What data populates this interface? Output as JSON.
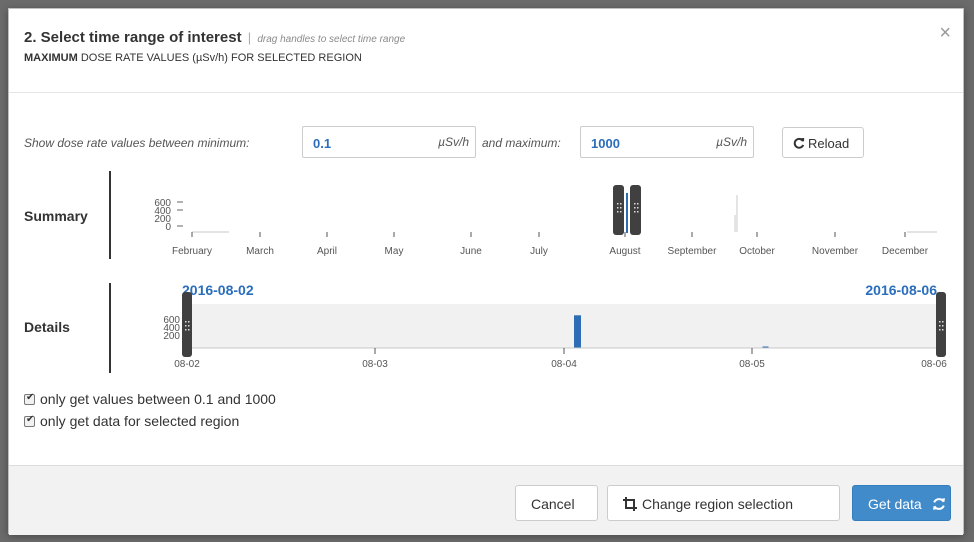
{
  "header": {
    "title": "2. Select time range of interest",
    "separator": "|",
    "hint": "drag handles to select time range",
    "subtitle_bold": "MAXIMUM",
    "subtitle_rest": " DOSE RATE VALUES (µSv/h) FOR SELECTED REGION",
    "close_symbol": "×"
  },
  "range": {
    "min_label": "Show dose rate values between minimum:",
    "min_value": "0.1",
    "min_unit": "µSv/h",
    "max_label": "and maximum:",
    "max_value": "1000",
    "max_unit": "µSv/h",
    "reload_label": "Reload"
  },
  "summary": {
    "label": "Summary",
    "y_ticks": [
      "600",
      "400",
      "200",
      "0"
    ],
    "months": [
      "February",
      "March",
      "April",
      "May",
      "June",
      "July",
      "August",
      "September",
      "October",
      "November",
      "December"
    ]
  },
  "details": {
    "label": "Details",
    "start_date": "2016-08-02",
    "end_date": "2016-08-06",
    "y_ticks": [
      "600",
      "400",
      "200"
    ],
    "x_ticks": [
      "08-02",
      "08-03",
      "08-04",
      "08-05",
      "08-06"
    ],
    "bars": [
      {
        "x": "2016-08-04",
        "value": 520
      },
      {
        "x": "2016-08-05",
        "value": 20
      }
    ]
  },
  "options": {
    "values_between": "only get values between 0.1 and 1000",
    "selected_region": "only get data for selected region"
  },
  "footer": {
    "cancel_label": "Cancel",
    "change_region_label": "Change region selection",
    "get_data_label": "Get data"
  },
  "colors": {
    "accent": "#2a6ebb",
    "bar": "#2e6db4",
    "primary_button": "#428bca",
    "handle": "#404040"
  }
}
